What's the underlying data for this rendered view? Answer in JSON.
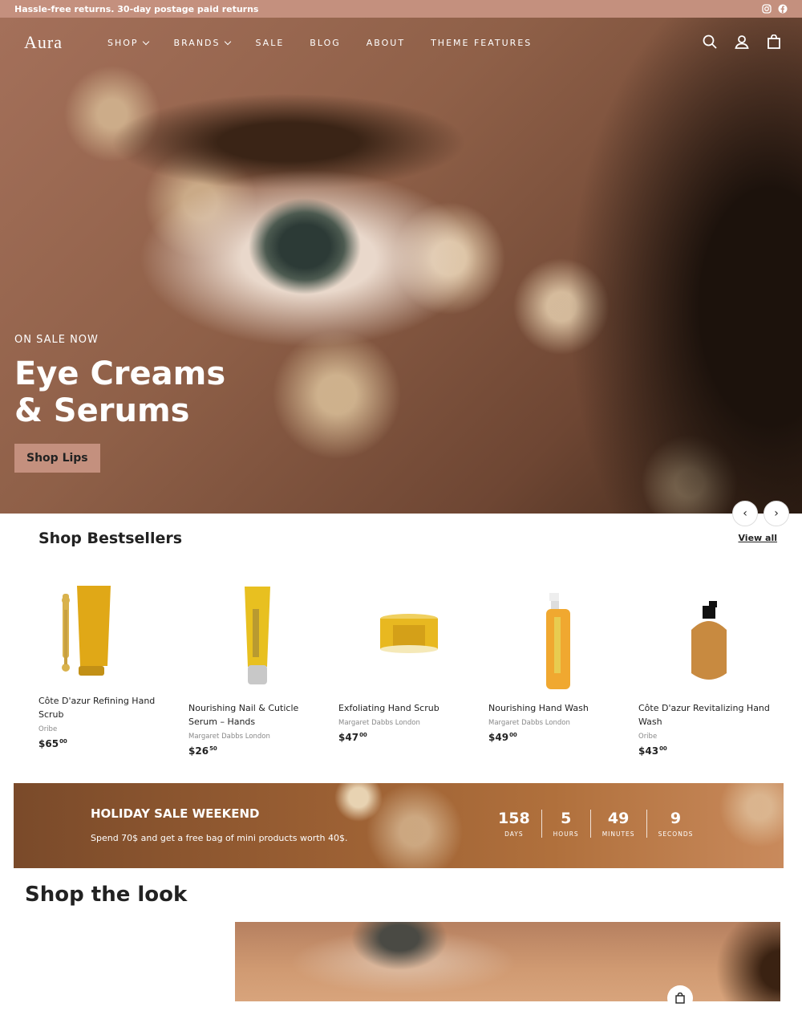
{
  "announcement": {
    "text": "Hassle-free returns. 30-day postage paid returns",
    "social_icons": [
      "instagram-icon",
      "facebook-icon"
    ]
  },
  "nav": {
    "logo": "Aura",
    "menu": [
      {
        "label": "SHOP",
        "has_dropdown": true
      },
      {
        "label": "BRANDS",
        "has_dropdown": true
      },
      {
        "label": "SALE",
        "has_dropdown": false
      },
      {
        "label": "BLOG",
        "has_dropdown": false
      },
      {
        "label": "ABOUT",
        "has_dropdown": false
      },
      {
        "label": "THEME FEATURES",
        "has_dropdown": false
      }
    ],
    "icons": [
      "search-icon",
      "account-icon",
      "cart-icon"
    ]
  },
  "hero": {
    "eyebrow": "ON SALE NOW",
    "title": "Eye Creams & Serums",
    "button": "Shop Lips",
    "prev_icon": "‹",
    "next_icon": "›"
  },
  "bestsellers": {
    "title": "Shop Bestsellers",
    "view_all": "View all",
    "products": [
      {
        "name": "Côte D'azur Refining Hand Scrub",
        "brand": "Oribe",
        "price": "$65",
        "cents": "00"
      },
      {
        "name": "Nourishing Nail & Cuticle Serum – Hands",
        "brand": "Margaret Dabbs London",
        "price": "$26",
        "cents": "50"
      },
      {
        "name": "Exfoliating Hand Scrub",
        "brand": "Margaret Dabbs London",
        "price": "$47",
        "cents": "00"
      },
      {
        "name": "Nourishing Hand Wash",
        "brand": "Margaret Dabbs London",
        "price": "$49",
        "cents": "00"
      },
      {
        "name": "Côte D'azur Revitalizing Hand Wash",
        "brand": "Oribe",
        "price": "$43",
        "cents": "00"
      }
    ]
  },
  "promo": {
    "title": "HOLIDAY SALE WEEKEND",
    "subtitle": "Spend 70$ and get a free bag of mini products worth 40$.",
    "countdown": [
      {
        "value": "158",
        "label": "DAYS"
      },
      {
        "value": "5",
        "label": "HOURS"
      },
      {
        "value": "49",
        "label": "MINUTES"
      },
      {
        "value": "9",
        "label": "SECONDS"
      }
    ]
  },
  "look": {
    "title": "Shop the look"
  },
  "colors": {
    "accent": "#c4907e",
    "text": "#222222"
  }
}
